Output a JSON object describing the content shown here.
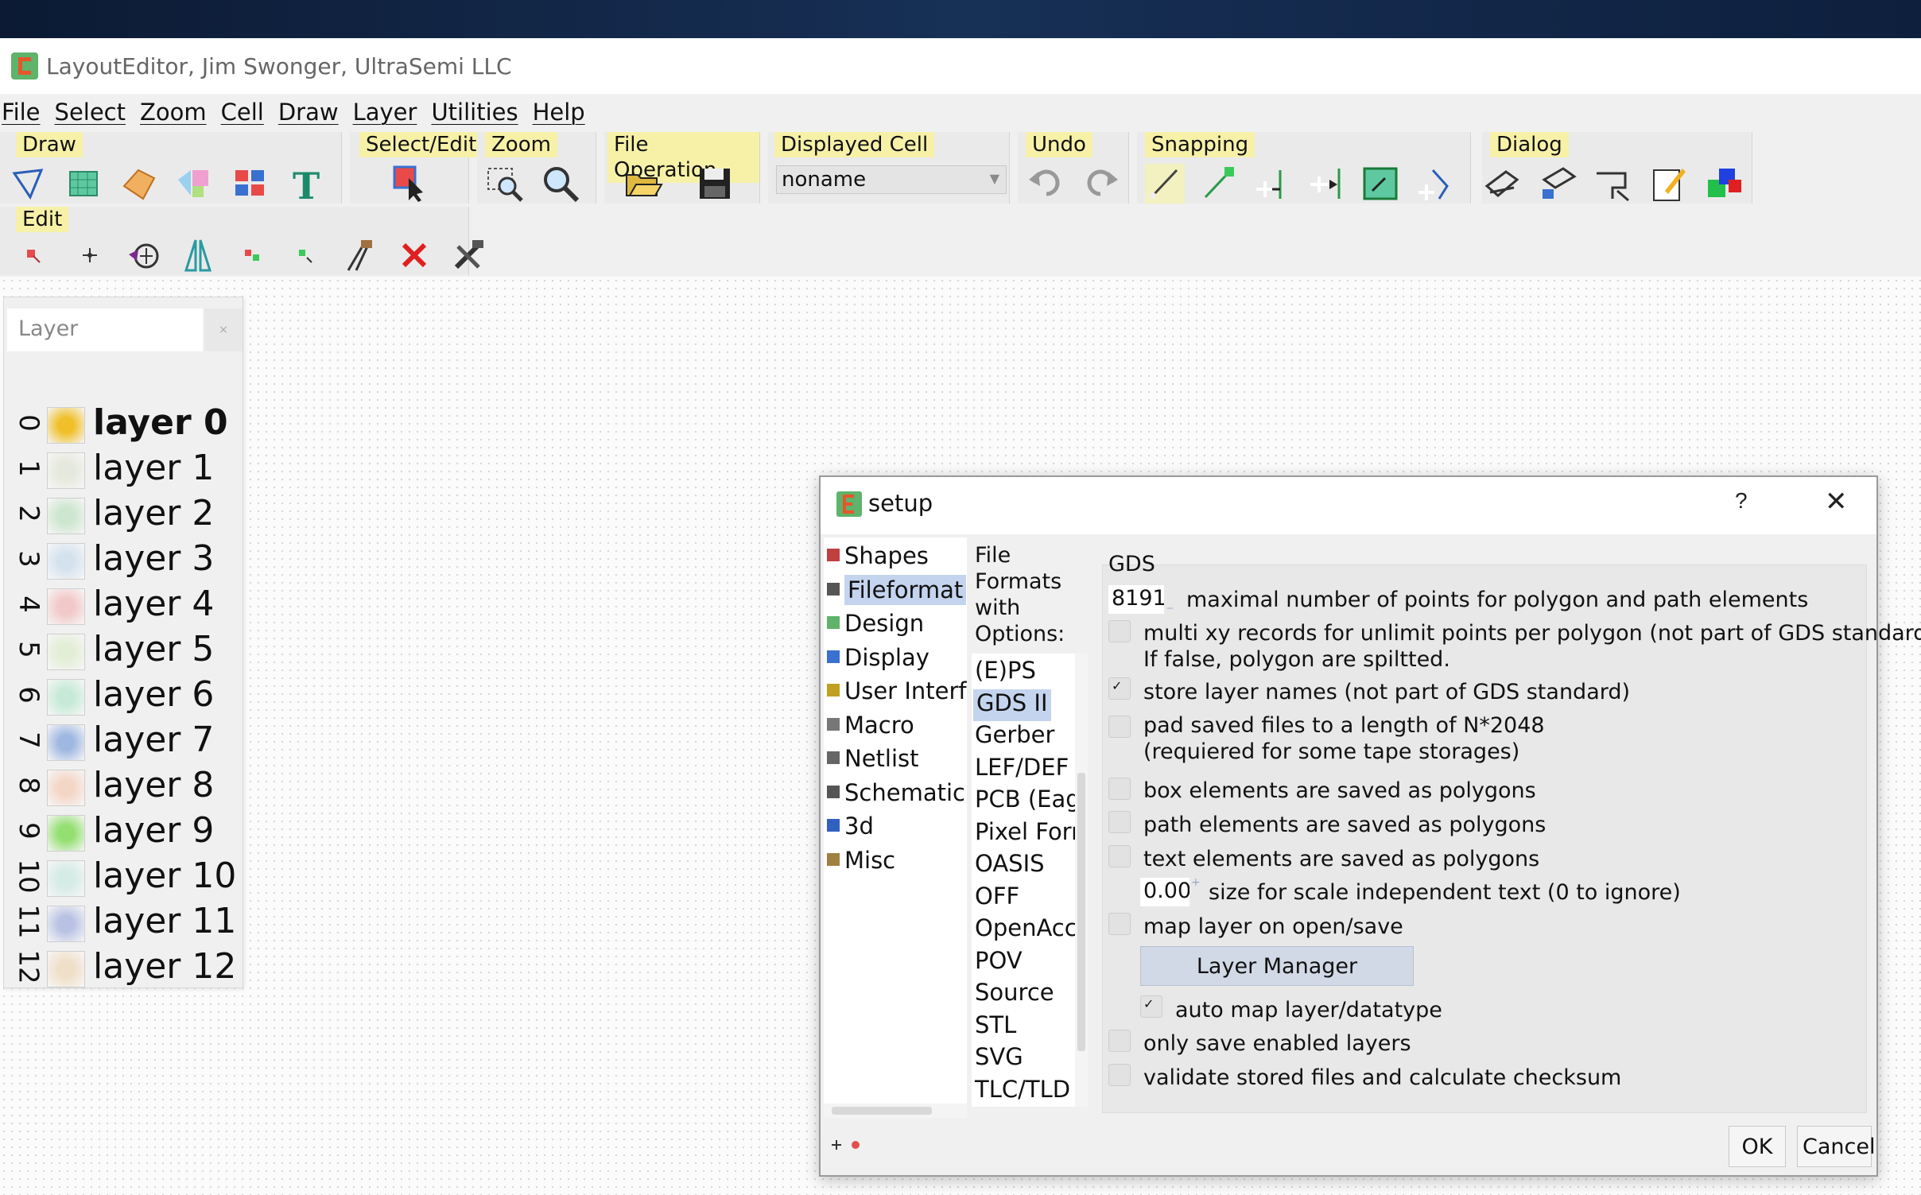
{
  "window": {
    "title": "LayoutEditor, Jim Swonger, UltraSemi LLC"
  },
  "menu": [
    "File",
    "Select",
    "Zoom",
    "Cell",
    "Draw",
    "Layer",
    "Utilities",
    "Help"
  ],
  "toolbar": {
    "groups": {
      "draw": "Draw",
      "select_edit": "Select/Edit",
      "zoom": "Zoom",
      "file_operation": "File Operation",
      "displayed_cell": "Displayed Cell",
      "undo": "Undo",
      "snapping": "Snapping",
      "dialog": "Dialog",
      "edit": "Edit"
    },
    "displayed_cell_value": "noname"
  },
  "layer_panel": {
    "search_placeholder": "Layer",
    "clear_glyph": "×",
    "layers": [
      {
        "num": "0",
        "name": "layer 0",
        "color": "#f0c02a",
        "bold": true
      },
      {
        "num": "1",
        "name": "layer 1",
        "color": "#e5e8dc"
      },
      {
        "num": "2",
        "name": "layer 2",
        "color": "#cde6cf"
      },
      {
        "num": "3",
        "name": "layer 3",
        "color": "#d4e2ee"
      },
      {
        "num": "4",
        "name": "layer 4",
        "color": "#f2c8c8"
      },
      {
        "num": "5",
        "name": "layer 5",
        "color": "#e3eed6"
      },
      {
        "num": "6",
        "name": "layer 6",
        "color": "#c6ead7"
      },
      {
        "num": "7",
        "name": "layer 7",
        "color": "#9fb8e2"
      },
      {
        "num": "8",
        "name": "layer 8",
        "color": "#f4d6c6"
      },
      {
        "num": "9",
        "name": "layer 9",
        "color": "#93e070"
      },
      {
        "num": "10",
        "name": "layer 10",
        "color": "#d5ebe6"
      },
      {
        "num": "11",
        "name": "layer 11",
        "color": "#b9c2e4"
      },
      {
        "num": "12",
        "name": "layer 12",
        "color": "#f0dfc8"
      }
    ]
  },
  "setup_dialog": {
    "title": "setup",
    "help": "?",
    "close": "✕",
    "categories": [
      {
        "label": "Shapes",
        "icon": "shapes-icon"
      },
      {
        "label": "Fileformat",
        "icon": "fileformat-icon",
        "selected": true
      },
      {
        "label": "Design",
        "icon": "design-icon"
      },
      {
        "label": "Display",
        "icon": "display-icon"
      },
      {
        "label": "User Interfa",
        "icon": "user-interface-icon"
      },
      {
        "label": "Macro",
        "icon": "macro-icon"
      },
      {
        "label": "Netlist",
        "icon": "netlist-icon"
      },
      {
        "label": "Schematic",
        "icon": "schematic-icon"
      },
      {
        "label": "3d",
        "icon": "3d-icon"
      },
      {
        "label": "Misc",
        "icon": "misc-icon"
      }
    ],
    "file_formats_label": "File Formats with Options:",
    "file_formats": [
      "(E)PS",
      "GDS II",
      "Gerber",
      "LEF/DEF",
      "PCB (Eag",
      "Pixel Forr",
      "OASIS",
      "OFF",
      "OpenAcc",
      "POV",
      "Source",
      "STL",
      "SVG",
      "TLC/TLD"
    ],
    "selected_format": "GDS II",
    "gds": {
      "title": "GDS",
      "max_points_value": "8191",
      "max_points_label": "maximal number of points for polygon and path elements",
      "multi_xy_label": "multi xy records for unlimit points per polygon (not part of GDS standard).",
      "multi_xy_label_2": "If false, polygon are spiltted.",
      "store_layer_names_label": "store layer names (not part of GDS standard)",
      "pad_label": "pad saved files to a length of N*2048",
      "pad_label_2": "(requiered for some tape storages)",
      "box_poly_label": "box elements are saved as polygons",
      "path_poly_label": "path elements are saved as polygons",
      "text_poly_label": "text elements are saved as polygons",
      "text_size_value": "0.00(",
      "text_size_label": "size for scale independent text (0 to ignore)",
      "map_layer_label": "map layer on open/save",
      "layer_manager_button": "Layer Manager",
      "auto_map_label": "auto map layer/datatype",
      "only_enabled_label": "only save enabled layers",
      "validate_label": "validate stored files and calculate checksum",
      "check_glyph": "✓"
    },
    "ok": "OK",
    "cancel": "Cancel"
  }
}
